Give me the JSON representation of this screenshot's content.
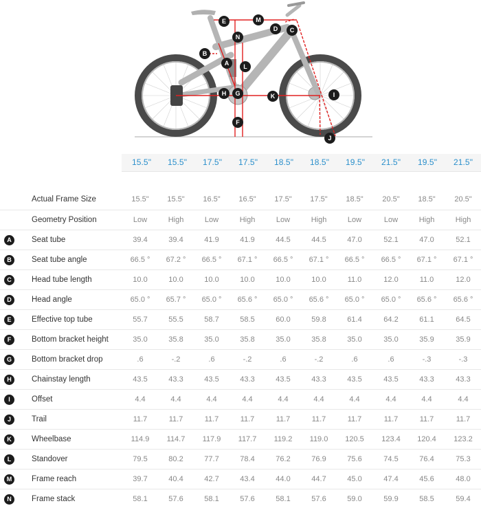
{
  "frame_sizes": [
    "15.5\"",
    "15.5\"",
    "17.5\"",
    "17.5\"",
    "18.5\"",
    "18.5\"",
    "19.5\"",
    "21.5\"",
    "19.5\"",
    "21.5\""
  ],
  "diagram": {
    "markers": [
      "A",
      "B",
      "C",
      "D",
      "E",
      "F",
      "G",
      "H",
      "I",
      "J",
      "K",
      "L",
      "M",
      "N"
    ],
    "line_color": "#e02020",
    "badge_color": "#1c1c1c"
  },
  "rows": [
    {
      "key": "",
      "label": "Actual Frame Size",
      "values": [
        "15.5\"",
        "15.5\"",
        "16.5\"",
        "16.5\"",
        "17.5\"",
        "17.5\"",
        "18.5\"",
        "20.5\"",
        "18.5\"",
        "20.5\""
      ]
    },
    {
      "key": "",
      "label": "Geometry Position",
      "values": [
        "Low",
        "High",
        "Low",
        "High",
        "Low",
        "High",
        "Low",
        "Low",
        "High",
        "High"
      ]
    },
    {
      "key": "A",
      "label": "Seat tube",
      "values": [
        "39.4",
        "39.4",
        "41.9",
        "41.9",
        "44.5",
        "44.5",
        "47.0",
        "52.1",
        "47.0",
        "52.1"
      ]
    },
    {
      "key": "B",
      "label": "Seat tube angle",
      "values": [
        "66.5 °",
        "67.2 °",
        "66.5 °",
        "67.1 °",
        "66.5 °",
        "67.1 °",
        "66.5 °",
        "66.5 °",
        "67.1 °",
        "67.1 °"
      ]
    },
    {
      "key": "C",
      "label": "Head tube length",
      "values": [
        "10.0",
        "10.0",
        "10.0",
        "10.0",
        "10.0",
        "10.0",
        "11.0",
        "12.0",
        "11.0",
        "12.0"
      ]
    },
    {
      "key": "D",
      "label": "Head angle",
      "values": [
        "65.0 °",
        "65.7 °",
        "65.0 °",
        "65.6 °",
        "65.0 °",
        "65.6 °",
        "65.0 °",
        "65.0 °",
        "65.6 °",
        "65.6 °"
      ]
    },
    {
      "key": "E",
      "label": "Effective top tube",
      "values": [
        "55.7",
        "55.5",
        "58.7",
        "58.5",
        "60.0",
        "59.8",
        "61.4",
        "64.2",
        "61.1",
        "64.5"
      ]
    },
    {
      "key": "F",
      "label": "Bottom bracket height",
      "values": [
        "35.0",
        "35.8",
        "35.0",
        "35.8",
        "35.0",
        "35.8",
        "35.0",
        "35.0",
        "35.9",
        "35.9"
      ]
    },
    {
      "key": "G",
      "label": "Bottom bracket drop",
      "values": [
        ".6",
        "-.2",
        ".6",
        "-.2",
        ".6",
        "-.2",
        ".6",
        ".6",
        "-.3",
        "-.3"
      ]
    },
    {
      "key": "H",
      "label": "Chainstay length",
      "values": [
        "43.5",
        "43.3",
        "43.5",
        "43.3",
        "43.5",
        "43.3",
        "43.5",
        "43.5",
        "43.3",
        "43.3"
      ]
    },
    {
      "key": "I",
      "label": "Offset",
      "values": [
        "4.4",
        "4.4",
        "4.4",
        "4.4",
        "4.4",
        "4.4",
        "4.4",
        "4.4",
        "4.4",
        "4.4"
      ]
    },
    {
      "key": "J",
      "label": "Trail",
      "values": [
        "11.7",
        "11.7",
        "11.7",
        "11.7",
        "11.7",
        "11.7",
        "11.7",
        "11.7",
        "11.7",
        "11.7"
      ]
    },
    {
      "key": "K",
      "label": "Wheelbase",
      "values": [
        "114.9",
        "114.7",
        "117.9",
        "117.7",
        "119.2",
        "119.0",
        "120.5",
        "123.4",
        "120.4",
        "123.2"
      ]
    },
    {
      "key": "L",
      "label": "Standover",
      "values": [
        "79.5",
        "80.2",
        "77.7",
        "78.4",
        "76.2",
        "76.9",
        "75.6",
        "74.5",
        "76.4",
        "75.3"
      ]
    },
    {
      "key": "M",
      "label": "Frame reach",
      "values": [
        "39.7",
        "40.4",
        "42.7",
        "43.4",
        "44.0",
        "44.7",
        "45.0",
        "47.4",
        "45.6",
        "48.0"
      ]
    },
    {
      "key": "N",
      "label": "Frame stack",
      "values": [
        "58.1",
        "57.6",
        "58.1",
        "57.6",
        "58.1",
        "57.6",
        "59.0",
        "59.9",
        "58.5",
        "59.4"
      ]
    }
  ]
}
